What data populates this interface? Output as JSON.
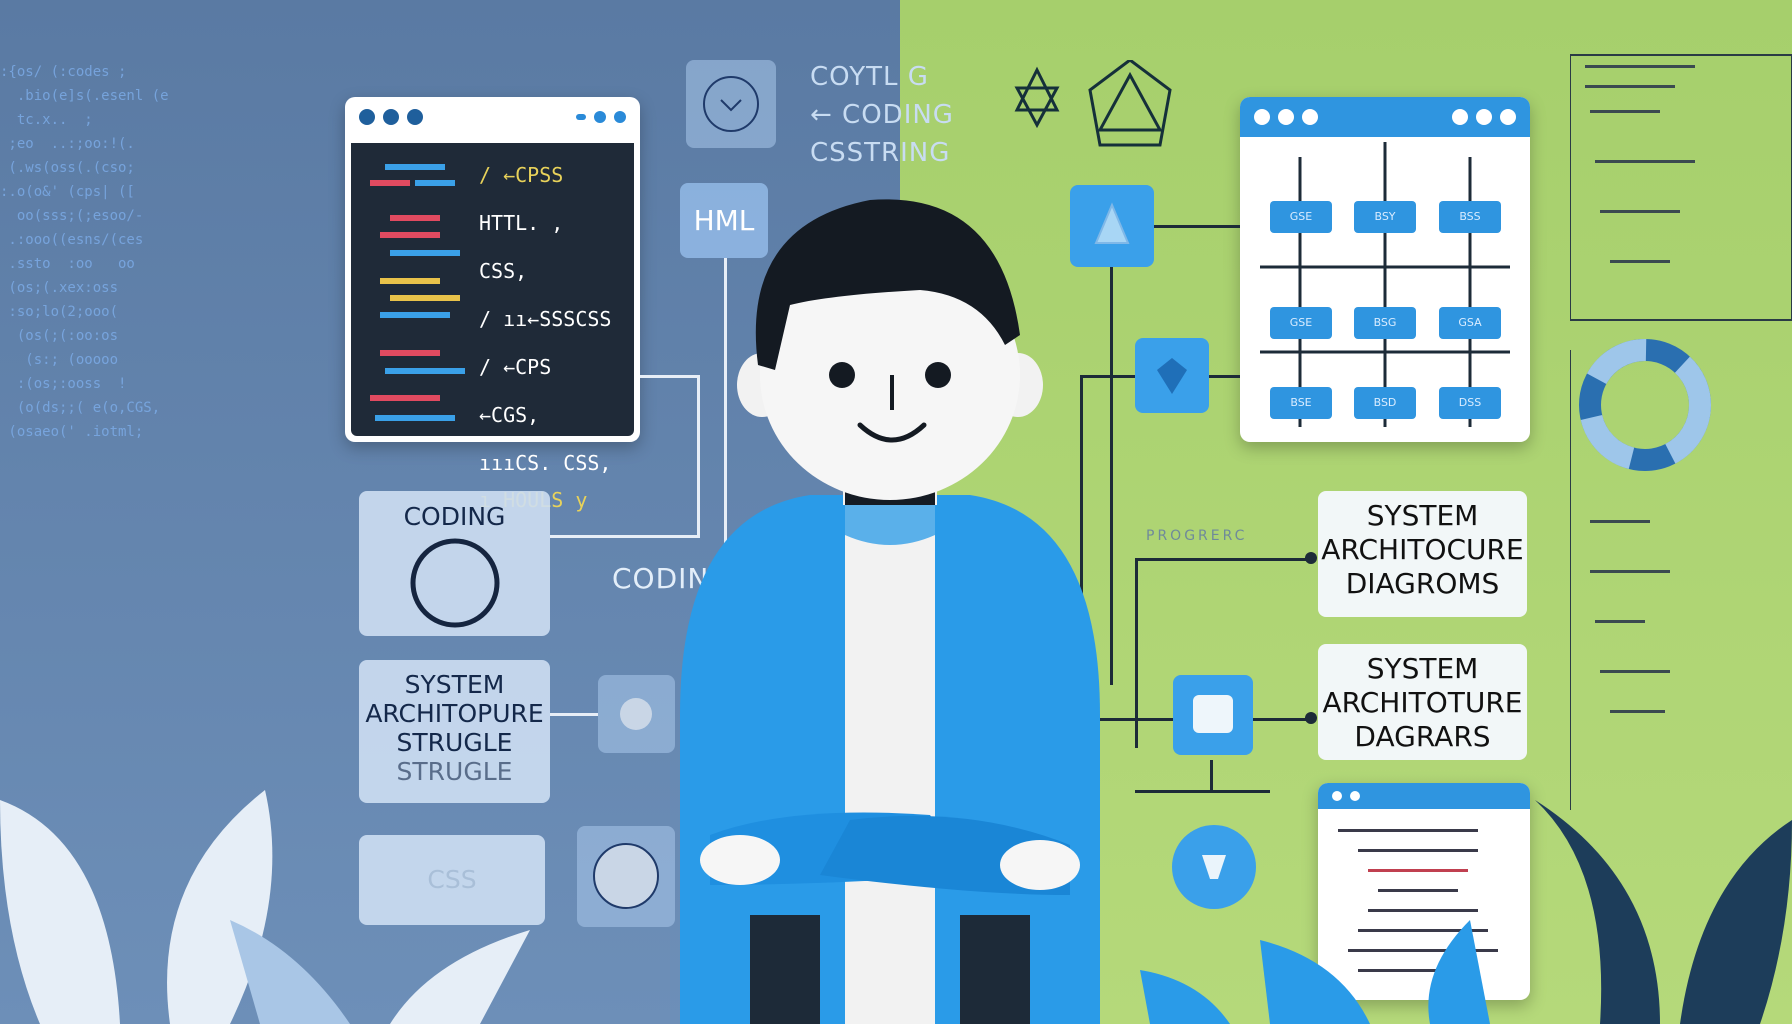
{
  "left_panel": {
    "code_window": {
      "lines": [
        "/ ←CPSS",
        "HTTL. , CSS,",
        "/ ıı←SSSCSS",
        "/ ←CPS ←CGS,",
        "ıııCS. CSS,",
        "ı HOULS y"
      ]
    },
    "html_tile": "HML",
    "floating_labels": [
      "COYTL G",
      "← CODING",
      "CSSTRING"
    ],
    "coding_caption": "CODING",
    "cards": [
      {
        "label": "CODING"
      },
      {
        "label": "SYSTEM ARCHITOPURE STRUGLE",
        "echo": "STRUGLE"
      },
      {
        "label": "CSS"
      }
    ]
  },
  "right_panel": {
    "diagram_window": {
      "nodes": [
        "GSE",
        "BSY",
        "BSS",
        "GSE",
        "BSG",
        "GSA",
        "BSE",
        "BSD",
        "DSS"
      ]
    },
    "progress_label": "PROGRERC",
    "cards": [
      {
        "label": "SYSTEM ARCHITOCURE DIAGROMS"
      },
      {
        "label": "SYSTEM ARCHITOTURE DAGRARS"
      }
    ]
  },
  "colors": {
    "left_bg": "#5d7fa8",
    "right_bg": "#a8d06c",
    "accent_blue": "#2f95e0",
    "hoodie": "#2a9be8"
  }
}
